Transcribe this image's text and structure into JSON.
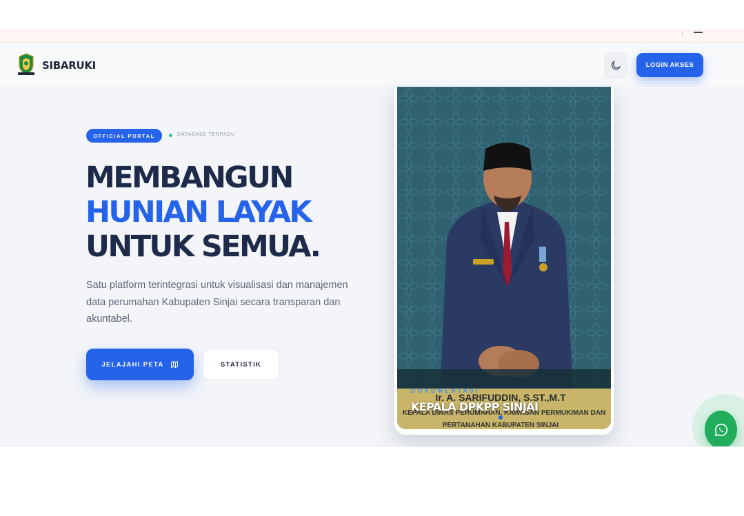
{
  "brand": {
    "name": "SIBARUKI"
  },
  "nav": {
    "login_label": "LOGIN AKSES",
    "theme_icon": "moon-icon"
  },
  "hero": {
    "badge": "OFFICIAL PORTAL",
    "badge_sub": "DATABASE TERPADU",
    "headline_1": "MEMBANGUN",
    "headline_2": "HUNIAN LAYAK",
    "headline_3": "UNTUK SEMUA.",
    "description": "Satu platform terintegrasi untuk visualisasi dan manajemen data perumahan Kabupaten Sinjai secara transparan dan akuntabel.",
    "btn_primary": "JELAJAHI PETA",
    "btn_primary_icon": "map-icon",
    "btn_secondary": "STATISTIK"
  },
  "photo": {
    "caption_small": "DOKUMENTASI",
    "caption_name": "KEPALA DPKPP SINJAI",
    "nameplate_1": "Ir. A. SARIFUDDIN, S.ST.,M.T",
    "nameplate_2": "KEPALA DINAS PERUMAHAN, KAWASAN PERMUKIMAN DAN",
    "nameplate_3": "PERTANAHAN KABUPATEN SINJAI"
  },
  "colors": {
    "primary": "#2563eb",
    "headline": "#1e2a4a",
    "whatsapp": "#21ad5c",
    "photo_bg": "#2f6170"
  },
  "floating": {
    "whatsapp_icon": "whatsapp-icon"
  }
}
